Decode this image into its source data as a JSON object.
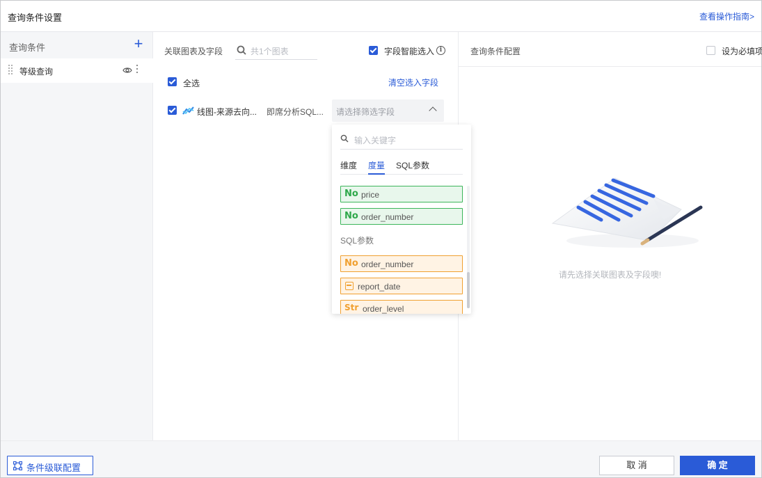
{
  "header": {
    "title": "查询条件设置",
    "guide_link": "查看操作指南>"
  },
  "left": {
    "title": "查询条件",
    "add_icon": "plus-icon",
    "items": [
      {
        "label": "等级查询",
        "icons": [
          "drag-handle-icon",
          "eye-icon",
          "more-vertical-icon"
        ]
      }
    ]
  },
  "middle": {
    "title": "关联图表及字段",
    "search_placeholder": "共1个图表",
    "smart_select_label": "字段智能选入",
    "smart_select_checked": true,
    "select_all_label": "全选",
    "select_all_checked": true,
    "clear_label": "清空选入字段",
    "chart_row": {
      "checked": true,
      "name": "线图-来源去向...",
      "source": "即席分析SQL...",
      "field_select_placeholder": "请选择筛选字段"
    }
  },
  "dropdown": {
    "keyword_placeholder": "输入关键字",
    "tabs": [
      "维度",
      "度量",
      "SQL参数"
    ],
    "active_tab": "度量",
    "measure_fields": [
      {
        "type_icon": "No",
        "name": "price"
      },
      {
        "type_icon": "No",
        "name": "order_number"
      }
    ],
    "sql_group_label": "SQL参数",
    "sql_fields": [
      {
        "type_icon": "No",
        "name": "order_number"
      },
      {
        "type_icon": "calendar-icon",
        "name": "report_date"
      },
      {
        "type_icon": "Str",
        "name": "order_level"
      }
    ]
  },
  "right": {
    "title": "查询条件配置",
    "required_label": "设为必填项",
    "required_checked": false,
    "empty_text": "请先选择关联图表及字段噢!"
  },
  "footer": {
    "cascade_label": "条件级联配置",
    "cancel_label": "取 消",
    "ok_label": "确 定"
  },
  "colors": {
    "accent": "#2a5bd7",
    "measure_green": "#3cb55a",
    "param_orange": "#f0a030"
  }
}
